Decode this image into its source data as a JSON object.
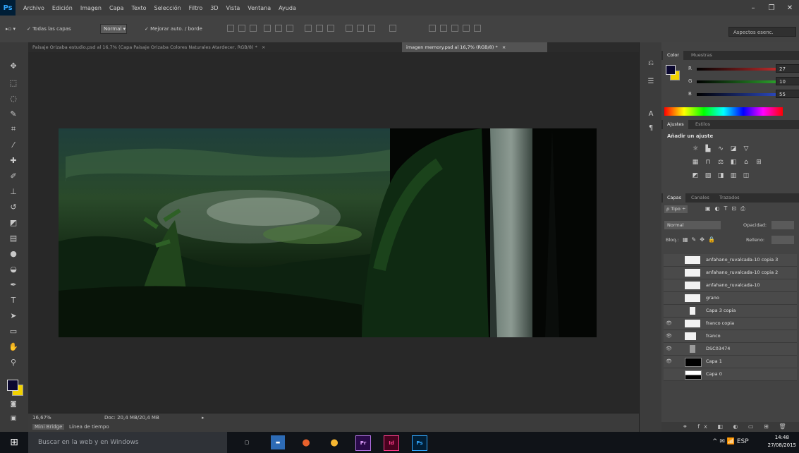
{
  "app": {
    "logo": "Ps"
  },
  "menu": [
    "Archivo",
    "Edición",
    "Imagen",
    "Capa",
    "Texto",
    "Selección",
    "Filtro",
    "3D",
    "Vista",
    "Ventana",
    "Ayuda"
  ],
  "window_controls": {
    "minimize": "–",
    "restore": "❐",
    "close": "✕"
  },
  "options_bar": {
    "tool_preset": "▸▫ ▾",
    "sample_all_layers": "✓ Todas las capas",
    "mode_select": "Normal ▾",
    "auto_enhance": "✓ Mejorar auto. / borde",
    "workspace": "Aspectos esenc."
  },
  "tabs": [
    {
      "label": "Paisaje Orizaba estudio.psd al 16,7% (Capa Paisaje Orizaba Colores Naturales Atardecer, RGB/8) *",
      "active": false
    },
    {
      "label": "imagen memory.psd al 16,7% (RGB/8) *",
      "active": true
    }
  ],
  "tab_close": "×",
  "status": {
    "zoom": "16,67%",
    "doc": "Doc: 20,4 MB/20,4 MB",
    "arrow": "▸",
    "mini_tabs": [
      "Mini Bridge",
      "Línea de tiempo"
    ]
  },
  "color_panel": {
    "tabs": [
      "Color",
      "Muestras"
    ],
    "foreground": "#0b0830",
    "background": "#f2d200",
    "channels": [
      {
        "label": "R",
        "value": "27",
        "color": "#d03030"
      },
      {
        "label": "G",
        "value": "10",
        "color": "#30b030"
      },
      {
        "label": "B",
        "value": "55",
        "color": "#3050d0"
      }
    ]
  },
  "adjustments_panel": {
    "tabs": [
      "Ajustes",
      "Estilos"
    ],
    "title": "Añadir un ajuste",
    "icons": [
      "brightness-icon",
      "levels-icon",
      "curves-icon",
      "exposure-icon",
      "gradient-triangle-icon",
      "vibrance-icon",
      "hue-icon",
      "color-balance-icon",
      "bw-icon",
      "photo-filter-icon",
      "channel-mixer-icon",
      "lookup-icon",
      "invert-icon",
      "posterize-icon",
      "threshold-icon",
      "gradient-map-icon",
      "selective-color-icon"
    ]
  },
  "layers_panel": {
    "tabs": [
      "Capas",
      "Canales",
      "Trazados"
    ],
    "kind_filter": "ρ Tipo ÷",
    "blend_mode": "Normal",
    "opacity_label": "Opacidad:",
    "lock_label": "Bloq.:",
    "fill_label": "Relleno:",
    "layers": [
      {
        "name": "anfahano_ruvalcada-10 copia 3",
        "eye": ""
      },
      {
        "name": "anfahano_ruvalcada-10 copia 2",
        "eye": ""
      },
      {
        "name": "anfahano_ruvalcada-10",
        "eye": ""
      },
      {
        "name": "grano",
        "eye": ""
      },
      {
        "name": "Capa 3 copia",
        "eye": ""
      },
      {
        "name": "franco copia",
        "eye": "👁"
      },
      {
        "name": "franco",
        "eye": "👁"
      },
      {
        "name": "DSC03474",
        "eye": "👁"
      },
      {
        "name": "Capa 1",
        "eye": "👁"
      },
      {
        "name": "Capa 0",
        "eye": ""
      }
    ],
    "footer_icons": "⚭ fx ◧ ◐ ▭ ⊞ 🗑"
  },
  "taskbar": {
    "start": "⊞",
    "search": "Buscar en la web y en Windows",
    "apps": [
      {
        "label": "▢",
        "bg": "#101318",
        "fg": "#dddddd"
      },
      {
        "label": "▬",
        "bg": "#2d6bb5",
        "fg": "#ffffff"
      },
      {
        "label": "●",
        "bg": "#101318",
        "fg": "#e8612c"
      },
      {
        "label": "●",
        "bg": "#101318",
        "fg": "#f7b731"
      },
      {
        "label": "Pr",
        "bg": "#2a0a4a",
        "fg": "#e0a0ff"
      },
      {
        "label": "Id",
        "bg": "#49021f",
        "fg": "#ff3d8b"
      },
      {
        "label": "Ps",
        "bg": "#001e36",
        "fg": "#31a8ff"
      }
    ],
    "tray": "^ ✉ 📶 ESP",
    "time": "14:48",
    "date": "27/08/2015"
  }
}
